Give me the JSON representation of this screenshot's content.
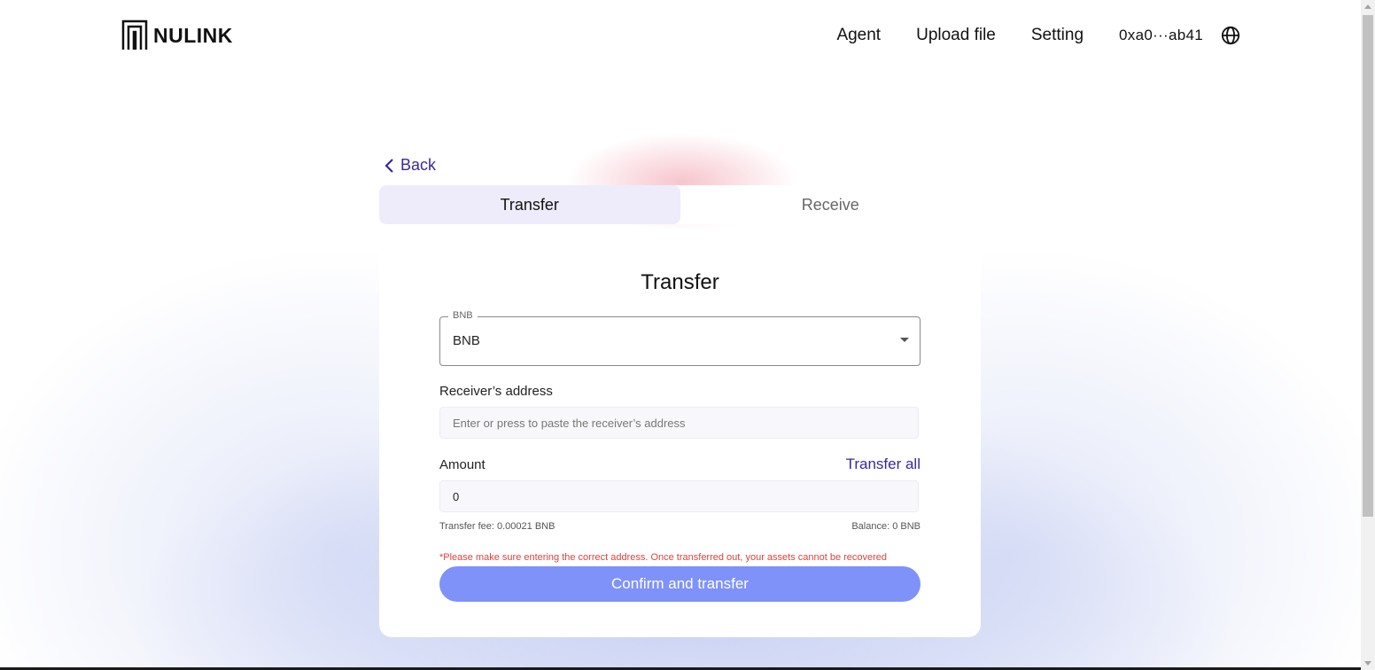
{
  "header": {
    "logo_text": "NULINK",
    "nav": {
      "agent": "Agent",
      "upload_file": "Upload file",
      "setting": "Setting",
      "address": "0xa0···ab41"
    },
    "language_icon": "globe-icon"
  },
  "back": {
    "label": "Back",
    "icon": "chevron-left-icon"
  },
  "tabs": [
    {
      "label": "Transfer",
      "active": true
    },
    {
      "label": "Receive",
      "active": false
    }
  ],
  "form": {
    "title": "Transfer",
    "token_select": {
      "legend": "BNB",
      "value": "BNB"
    },
    "receiver": {
      "label": "Receiver’s address",
      "placeholder": "Enter or press to paste the receiver’s address",
      "value": ""
    },
    "amount": {
      "label": "Amount",
      "transfer_all": "Transfer all",
      "value": "0"
    },
    "fee": "Transfer fee: 0.00021 BNB",
    "balance": "Balance: 0 BNB",
    "warning": "*Please make sure entering the correct address. Once transferred out, your assets cannot be recovered",
    "confirm_label": "Confirm and transfer"
  },
  "colors": {
    "accent": "#3a2a9a",
    "button": "#7f92f9",
    "warning": "#e0413a",
    "active_tab": "#eeecfb"
  }
}
